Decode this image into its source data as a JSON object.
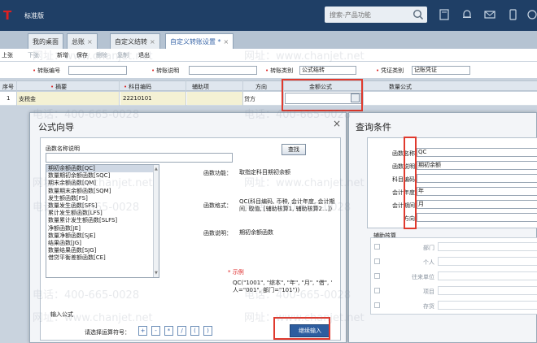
{
  "topbar": {
    "logo": "T",
    "edition": "标准版",
    "search_placeholder": "搜索-产品功能"
  },
  "tabs": [
    {
      "label": "我的桌面"
    },
    {
      "label": "总账"
    },
    {
      "label": "自定义结转"
    },
    {
      "label": "自定义转账设置 *"
    }
  ],
  "toolbar": {
    "first": "上张",
    "prev": "下张",
    "add": "新增",
    "save": "保存",
    "delete": "删除",
    "copy": "复制",
    "exit": "退出"
  },
  "form": {
    "code_label": "转账编号",
    "desc_label": "转账说明",
    "type_label": "转账类别",
    "type_value": "公式结转",
    "voucher_label": "凭证类别",
    "voucher_value": "记账凭证"
  },
  "grid": {
    "headers": [
      "序号",
      "摘要",
      "科目编码",
      "辅助项",
      "方向",
      "金额公式",
      "数量公式"
    ],
    "row": {
      "no": "1",
      "summary": "支税金",
      "code": "22210101",
      "direction": "贷方"
    }
  },
  "formula_dialog": {
    "title": "公式向导",
    "list_label": "函数名称说明",
    "search_button": "查找",
    "functions": [
      "期初余额函数[QC]",
      "数量期初余额函数[SQC]",
      "期末余额函数[QM]",
      "数量期末余额函数[SQM]",
      "发生额函数[FS]",
      "数量发生函数[SFS]",
      "累计发生额函数[LFS]",
      "数量累计发生额函数[SLFS]",
      "净额函数[JE]",
      "数量净额函数[SJE]",
      "结果函数[JG]",
      "数量结果函数[SJG]",
      "借贷平衡差额函数[CE]"
    ],
    "func_label": "函数功能：",
    "func_value": "取指定科目期初余额",
    "format_label": "函数格式：",
    "format_value_1": "QC(科目编码, 币种, 会计年度, 会计期",
    "format_value_2": "间, 取值, [辅助核算1, 辅助核算2...])",
    "desc_label": "函数说明：",
    "desc_value": "期初余额函数",
    "example_label": "* 示例",
    "example_line_1": "QC(\"1001\", \"综本\", \"年\", \"月\", \"借\", \"本币\",",
    "example_line_2": "人=\"001\", 部门=\"101\"))",
    "input_label": "输入公式",
    "operator_label": "请选择运算符号：",
    "operators": [
      "+",
      "-",
      "*",
      "/",
      "(",
      ")"
    ],
    "ok_button": "继续输入"
  },
  "query_dialog": {
    "title": "查询条件",
    "fields": [
      {
        "label": "函数名称",
        "value": "QC"
      },
      {
        "label": "函数说明",
        "value": "期初余额"
      },
      {
        "label": "科目编码",
        "value": ""
      },
      {
        "label": "会计年度",
        "value": "年"
      },
      {
        "label": "会计期间",
        "value": "月"
      },
      {
        "label": "方向",
        "value": ""
      }
    ],
    "assist_label": "辅助核算",
    "assist_items": [
      "部门",
      "个人",
      "往来单位",
      "项目",
      "存货"
    ]
  },
  "watermark": {
    "phone": "电话：400-665-0028",
    "site": "网址：www.chanjet.net"
  },
  "colors": {
    "titlebar": "#1f3f66",
    "highlight": "#e03a2e",
    "primary_button": "#2d5d9f"
  }
}
